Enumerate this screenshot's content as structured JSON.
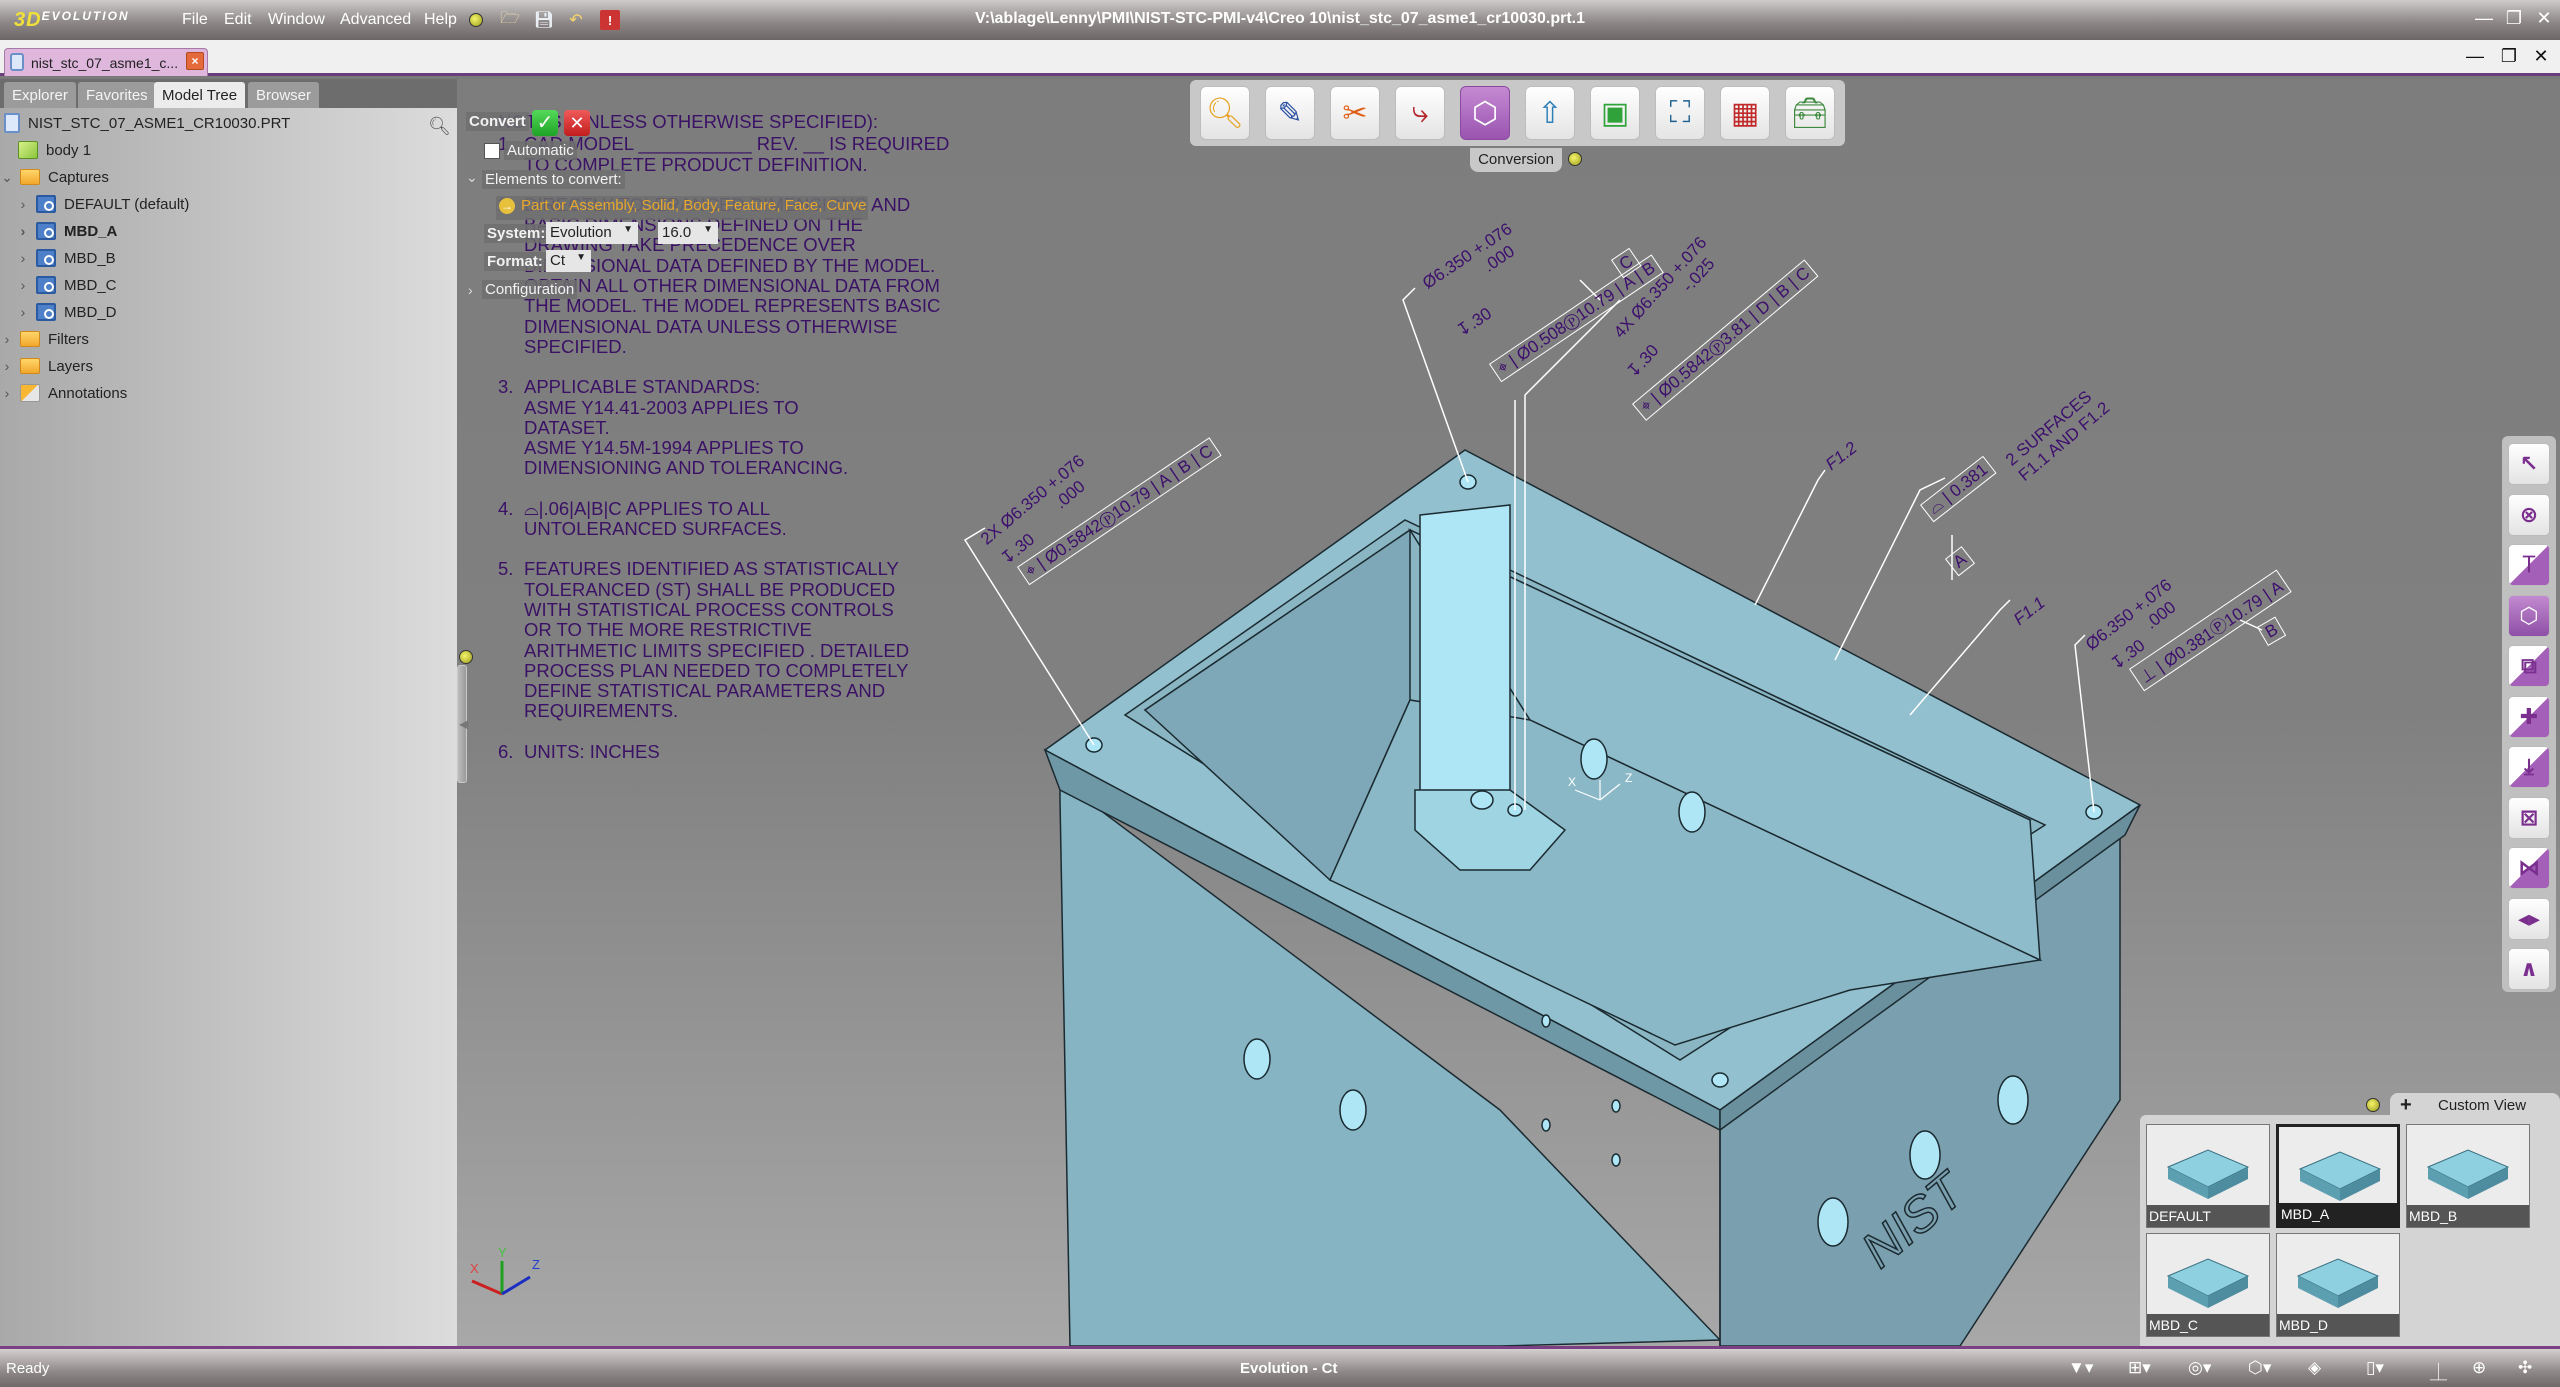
{
  "app": {
    "logo": "3D",
    "logo_sub": "EVOLUTION",
    "window_title": "V:\\ablage\\Lenny\\PMI\\NIST-STC-PMI-v4\\Creo 10\\nist_stc_07_asme1_cr10030.prt.1",
    "menu": [
      "File",
      "Edit",
      "Window",
      "Advanced",
      "Help"
    ],
    "quick_icons": [
      "pin-icon",
      "open-folder-icon",
      "save-icon",
      "undo-icon",
      "report-icon"
    ]
  },
  "document_tab": {
    "label": "nist_stc_07_asme1_c..."
  },
  "left_panel": {
    "tabs": [
      {
        "label": "Explorer",
        "active": false
      },
      {
        "label": "Favorites",
        "active": false
      },
      {
        "label": "Model Tree",
        "active": true
      },
      {
        "label": "Browser",
        "active": false
      }
    ],
    "tree": [
      {
        "label": "NIST_STC_07_ASME1_CR10030.PRT",
        "icon": "part-icon",
        "level": 0,
        "expander": ""
      },
      {
        "label": "body 1",
        "icon": "body-icon",
        "level": 1,
        "expander": ""
      },
      {
        "label": "Captures",
        "icon": "folder-icon",
        "level": 0,
        "expander": "expanded"
      },
      {
        "label": "DEFAULT (default)",
        "icon": "capture-icon",
        "level": 1,
        "expander": "collapsed"
      },
      {
        "label": "MBD_A",
        "icon": "capture-icon",
        "level": 1,
        "expander": "collapsed",
        "bold": true
      },
      {
        "label": "MBD_B",
        "icon": "capture-icon",
        "level": 1,
        "expander": "collapsed"
      },
      {
        "label": "MBD_C",
        "icon": "capture-icon",
        "level": 1,
        "expander": "collapsed"
      },
      {
        "label": "MBD_D",
        "icon": "capture-icon",
        "level": 1,
        "expander": "collapsed"
      },
      {
        "label": "Filters",
        "icon": "folder-icon",
        "level": 0,
        "expander": "collapsed"
      },
      {
        "label": "Layers",
        "icon": "folder-icon",
        "level": 0,
        "expander": "collapsed"
      },
      {
        "label": "Annotations",
        "icon": "annotations-icon",
        "level": 0,
        "expander": "collapsed"
      }
    ]
  },
  "convert_panel": {
    "title": "Convert",
    "automatic_label": "Automatic",
    "automatic_checked": false,
    "elements_label": "Elements to convert:",
    "elements_value": "Part or Assembly, Solid, Body, Feature, Face, Curve",
    "system_label": "System:",
    "system_value": "Evolution",
    "version_value": "16.0",
    "format_label": "Format:",
    "format_value": "Ct",
    "configuration_label": "Configuration"
  },
  "notes": {
    "header": "NOTES (UNLESS OTHERWISE SPECIFIED):",
    "items": [
      {
        "num": "1.",
        "lines": [
          "CAD MODEL ___________ REV. __ IS REQUIRED",
          "TO COMPLETE PRODUCT DEFINITION."
        ]
      },
      {
        "num": "2.",
        "lines": [
          "DIRECTLY TOLERANCED DIMENSIONS AND",
          "BASIC DIMENSIONS DEFINED ON THE",
          "DRAWING TAKE PRECEDENCE OVER",
          "DIMENSIONAL DATA DEFINED BY THE MODEL.",
          "OBTAIN ALL OTHER DIMENSIONAL DATA FROM",
          "THE MODEL. THE MODEL REPRESENTS BASIC",
          "DIMENSIONAL DATA UNLESS OTHERWISE",
          "SPECIFIED."
        ]
      },
      {
        "num": "3.",
        "lines": [
          "APPLICABLE STANDARDS:",
          "ASME Y14.41-2003 APPLIES TO",
          "DATASET.",
          "ASME Y14.5M-1994 APPLIES TO",
          "DIMENSIONING AND TOLERANCING."
        ]
      },
      {
        "num": "4.",
        "lines": [
          "⌓|.06|A|B|C APPLIES TO ALL",
          "UNTOLERANCED SURFACES."
        ]
      },
      {
        "num": "5.",
        "lines": [
          "FEATURES IDENTIFIED AS STATISTICALLY",
          "TOLERANCED (ST) SHALL BE PRODUCED",
          "WITH STATISTICAL PROCESS CONTROLS",
          "OR TO THE MORE RESTRICTIVE",
          "ARITHMETIC LIMITS SPECIFIED . DETAILED",
          "PROCESS PLAN NEEDED TO COMPLETELY",
          "DEFINE STATISTICAL PARAMETERS AND",
          "REQUIREMENTS."
        ]
      },
      {
        "num": "6.",
        "lines": [
          "UNITS: INCHES"
        ]
      }
    ]
  },
  "top_toolbar": {
    "tab_label": "Conversion",
    "buttons": [
      {
        "icon": "inspect-icon",
        "active": false
      },
      {
        "icon": "edit-icon",
        "active": false
      },
      {
        "icon": "tools-icon",
        "active": false
      },
      {
        "icon": "pmi-transfer-icon",
        "active": false
      },
      {
        "icon": "conversion-icon",
        "active": true
      },
      {
        "icon": "export-icon",
        "active": false
      },
      {
        "icon": "frame-icon",
        "active": false
      },
      {
        "icon": "structure-icon",
        "active": false
      },
      {
        "icon": "drawing-icon",
        "active": false
      },
      {
        "icon": "toolbox-icon",
        "active": false
      }
    ]
  },
  "right_toolbar": {
    "buttons": [
      {
        "icon": "select-arrow-icon"
      },
      {
        "icon": "cancel-icon"
      },
      {
        "icon": "measure-icon"
      },
      {
        "icon": "convert-icon",
        "active": true
      },
      {
        "icon": "split-icon"
      },
      {
        "icon": "add-icon"
      },
      {
        "icon": "insert-icon"
      },
      {
        "icon": "box-cross-icon"
      },
      {
        "icon": "join-icon"
      },
      {
        "icon": "separate-icon"
      },
      {
        "icon": "collapse-up-icon"
      }
    ]
  },
  "pmi_annotations": {
    "top_hole": [
      "Ø6.350 +.076",
      ".000",
      "↧.30",
      "⌖ | Ø0.508Ⓟ10.79 | A | B",
      "C"
    ],
    "four_x": [
      "4X Ø6.350 +.076",
      "-.025",
      "↧.30",
      "⌖ | Ø0.5842Ⓟ3.81 | D | B | C"
    ],
    "two_x": [
      "2X Ø6.350 +.076",
      ".000",
      "↧.30",
      "⌖ | Ø0.5842Ⓟ10.79 | A | B | C"
    ],
    "profile": [
      "⌓ | 0.381",
      "2 SURFACES",
      "F1.1 AND F1.2",
      "A"
    ],
    "right_hole": [
      "Ø6.350 +.076",
      ".000",
      "↧.30",
      "⊥ | Ø0.381Ⓟ10.79 | A",
      "B"
    ],
    "labels": [
      "F1.2",
      "F1.1"
    ],
    "model_text": "NIST"
  },
  "axis_triad": {
    "x": "X",
    "y": "Y",
    "z": "Z"
  },
  "custom_view": {
    "tab_label": "Custom View",
    "views": [
      {
        "label": "DEFAULT",
        "selected": false
      },
      {
        "label": "MBD_A",
        "selected": true
      },
      {
        "label": "MBD_B",
        "selected": false
      },
      {
        "label": "MBD_C",
        "selected": false
      },
      {
        "label": "MBD_D",
        "selected": false
      }
    ]
  },
  "status_bar": {
    "left": "Ready",
    "center": "Evolution - Ct",
    "icons": [
      "filter-icon",
      "hierarchy-icon",
      "visibility-icon",
      "view-cube-icon",
      "shading-icon",
      "display-mode-icon",
      "plane-icon",
      "center-icon",
      "pan-icon"
    ]
  }
}
